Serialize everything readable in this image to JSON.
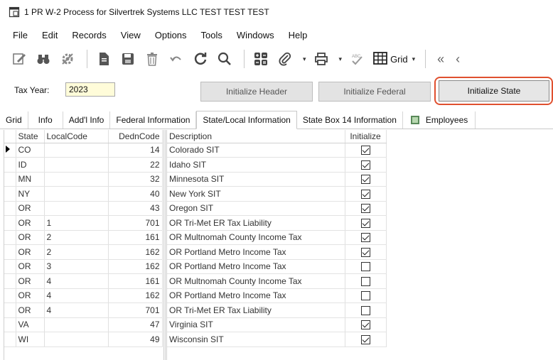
{
  "window": {
    "title": "1 PR W-2 Process for Silvertrek Systems LLC TEST TEST TEST"
  },
  "menu": [
    "File",
    "Edit",
    "Records",
    "View",
    "Options",
    "Tools",
    "Windows",
    "Help"
  ],
  "toolbar": {
    "grid_label": "Grid",
    "nav_back": "«",
    "nav_prev": "‹"
  },
  "tax_year": {
    "label": "Tax Year:",
    "value": "2023"
  },
  "buttons": {
    "init_header": "Initialize Header",
    "init_federal": "Initialize Federal",
    "init_state": "Initialize State"
  },
  "tabs": [
    "Grid",
    "Info",
    "Add'l Info",
    "Federal Information",
    "State/Local Information",
    "State Box 14 Information",
    "Employees"
  ],
  "active_tab": "State/Local Information",
  "left_columns": {
    "state": "State",
    "local": "LocalCode",
    "dedn": "DednCode"
  },
  "right_columns": {
    "desc": "Description",
    "init": "Initialize"
  },
  "rows": [
    {
      "state": "CO",
      "local": "",
      "dedn": "14",
      "desc": "Colorado SIT",
      "init": true
    },
    {
      "state": "ID",
      "local": "",
      "dedn": "22",
      "desc": "Idaho SIT",
      "init": true
    },
    {
      "state": "MN",
      "local": "",
      "dedn": "32",
      "desc": "Minnesota SIT",
      "init": true
    },
    {
      "state": "NY",
      "local": "",
      "dedn": "40",
      "desc": "New York SIT",
      "init": true
    },
    {
      "state": "OR",
      "local": "",
      "dedn": "43",
      "desc": "Oregon SIT",
      "init": true
    },
    {
      "state": "OR",
      "local": "1",
      "dedn": "701",
      "desc": "OR Tri-Met ER Tax Liability",
      "init": true
    },
    {
      "state": "OR",
      "local": "2",
      "dedn": "161",
      "desc": "OR Multnomah County Income Tax",
      "init": true
    },
    {
      "state": "OR",
      "local": "2",
      "dedn": "162",
      "desc": "OR Portland Metro Income Tax",
      "init": true
    },
    {
      "state": "OR",
      "local": "3",
      "dedn": "162",
      "desc": "OR Portland Metro Income Tax",
      "init": false
    },
    {
      "state": "OR",
      "local": "4",
      "dedn": "161",
      "desc": "OR Multnomah County Income Tax",
      "init": false
    },
    {
      "state": "OR",
      "local": "4",
      "dedn": "162",
      "desc": "OR Portland Metro Income Tax",
      "init": false
    },
    {
      "state": "OR",
      "local": "4",
      "dedn": "701",
      "desc": "OR Tri-Met ER Tax Liability",
      "init": false
    },
    {
      "state": "VA",
      "local": "",
      "dedn": "47",
      "desc": "Virginia SIT",
      "init": true
    },
    {
      "state": "WI",
      "local": "",
      "dedn": "49",
      "desc": "Wisconsin SIT",
      "init": true
    }
  ],
  "icons": {
    "app": "window-icon",
    "toolbar": [
      "edit-icon",
      "binoculars-icon",
      "settings-icon",
      "document-icon",
      "save-icon",
      "delete-icon",
      "undo-icon",
      "refresh-icon",
      "search-icon",
      "calculator-icon",
      "attachment-icon",
      "print-icon",
      "spellcheck-icon",
      "grid-icon"
    ]
  },
  "colors": {
    "highlight_outline": "#e0502f",
    "year_input_bg": "#fffcd9"
  }
}
